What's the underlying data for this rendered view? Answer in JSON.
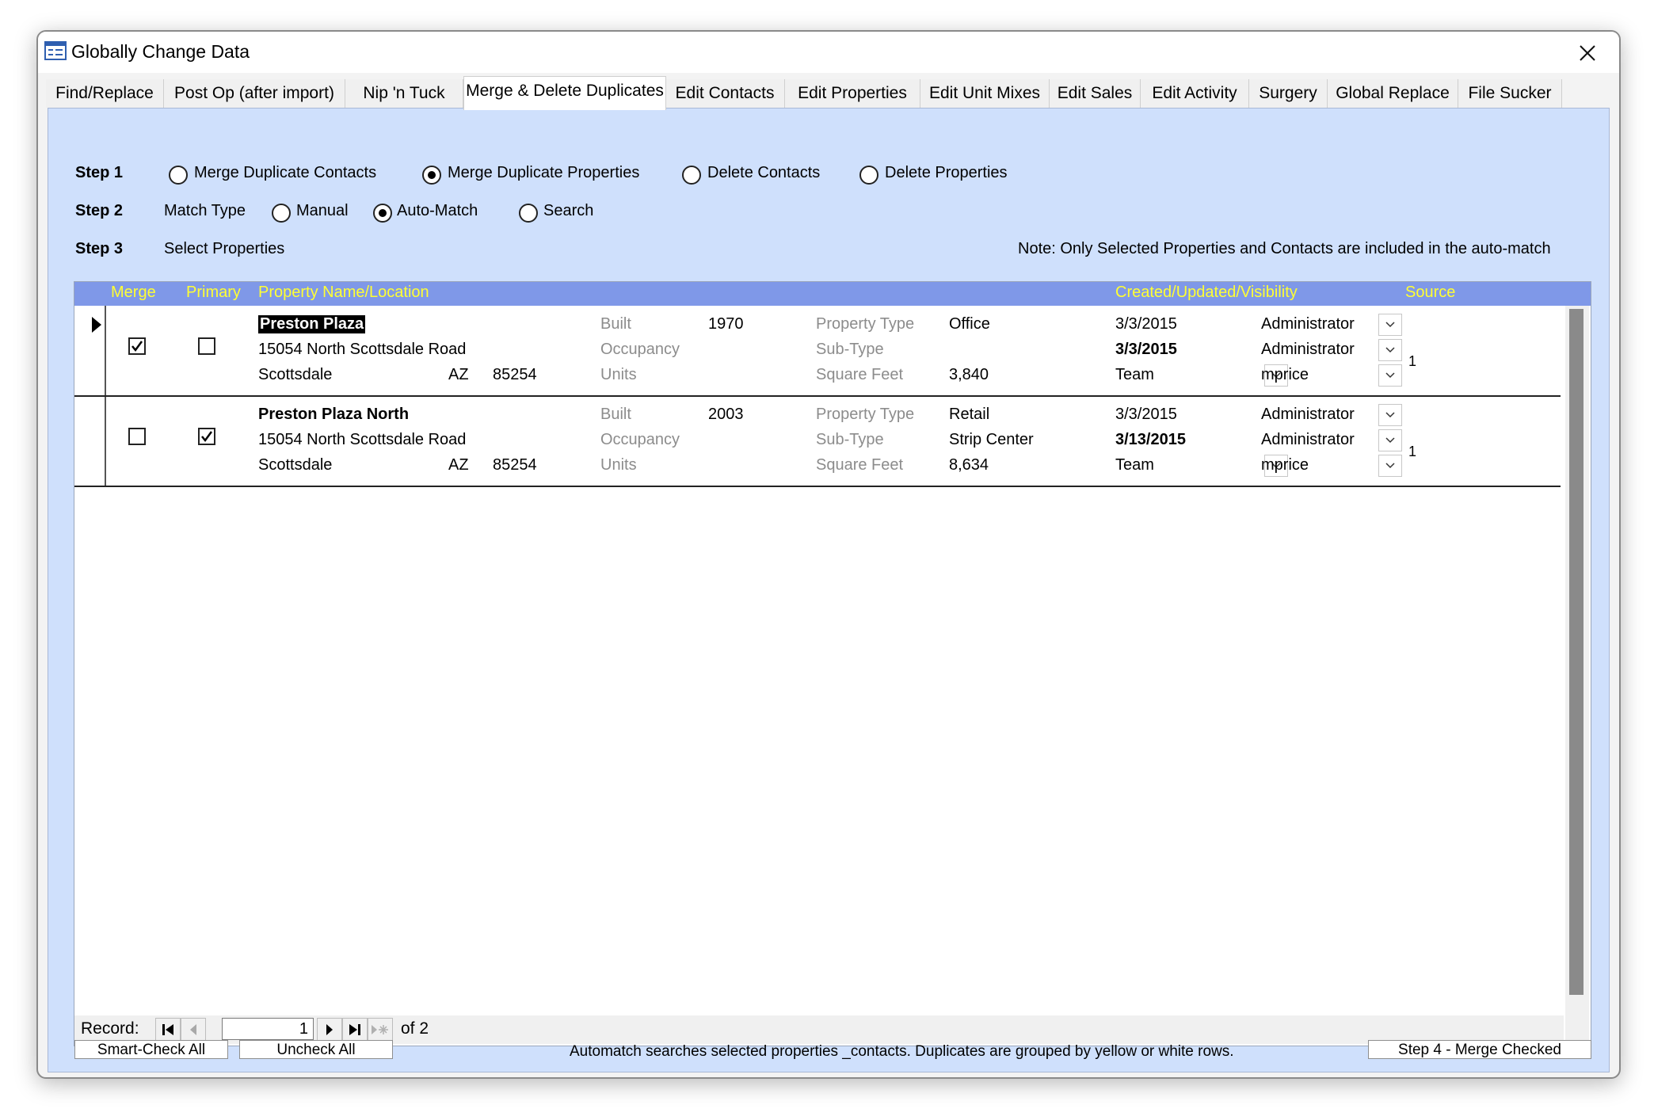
{
  "window": {
    "title": "Globally Change Data"
  },
  "tabs": [
    {
      "label": "Find/Replace"
    },
    {
      "label": "Post Op (after import)"
    },
    {
      "label": "Nip 'n Tuck"
    },
    {
      "label": "Merge & Delete Duplicates",
      "active": true
    },
    {
      "label": "Edit Contacts"
    },
    {
      "label": "Edit Properties"
    },
    {
      "label": "Edit Unit Mixes"
    },
    {
      "label": "Edit Sales"
    },
    {
      "label": "Edit Activity"
    },
    {
      "label": "Surgery"
    },
    {
      "label": "Global Replace"
    },
    {
      "label": "File Sucker"
    }
  ],
  "step1": {
    "label": "Step 1",
    "options": [
      {
        "label": "Merge Duplicate Contacts",
        "selected": false
      },
      {
        "label": "Merge Duplicate Properties",
        "selected": true
      },
      {
        "label": "Delete Contacts",
        "selected": false
      },
      {
        "label": "Delete Properties",
        "selected": false
      }
    ]
  },
  "step2": {
    "label": "Step 2",
    "match_type_label": "Match Type",
    "options": [
      {
        "label": "Manual",
        "selected": false
      },
      {
        "label": "Auto-Match",
        "selected": true
      },
      {
        "label": "Search",
        "selected": false
      }
    ]
  },
  "step3": {
    "label": "Step 3",
    "text": "Select Properties",
    "note": "Note:  Only Selected Properties and Contacts are included in the auto-match"
  },
  "grid": {
    "headers": {
      "merge": "Merge",
      "primary": "Primary",
      "property": "Property Name/Location",
      "created": "Created/Updated/Visibility",
      "source": "Source"
    },
    "field_labels": {
      "built": "Built",
      "occupancy": "Occupancy",
      "units": "Units",
      "property_type": "Property Type",
      "sub_type": "Sub-Type",
      "square_feet": "Square Feet"
    },
    "rows": [
      {
        "merge": true,
        "primary": false,
        "current": true,
        "name": "Preston Plaza",
        "address": "15054 North Scottsdale Road",
        "city": "Scottsdale",
        "state": "AZ",
        "zip": "85254",
        "built": "1970",
        "occupancy": "",
        "units": "",
        "property_type": "Office",
        "sub_type": "",
        "square_feet": "3,840",
        "created": "3/3/2015",
        "updated": "3/3/2015",
        "visibility": "Team",
        "created_by": "Administrator",
        "updated_by": "Administrator",
        "owner": "mprice",
        "source": "1"
      },
      {
        "merge": false,
        "primary": true,
        "current": false,
        "name": "Preston Plaza North",
        "address": "15054 North Scottsdale Road",
        "city": "Scottsdale",
        "state": "AZ",
        "zip": "85254",
        "built": "2003",
        "occupancy": "",
        "units": "",
        "property_type": "Retail",
        "sub_type": "Strip Center",
        "square_feet": "8,634",
        "created": "3/3/2015",
        "updated": "3/13/2015",
        "visibility": "Team",
        "created_by": "Administrator",
        "updated_by": "Administrator",
        "owner": "mprice",
        "source": "1"
      }
    ]
  },
  "navigation": {
    "record_label": "Record:",
    "current": "1",
    "of_label": "of 2"
  },
  "footer": {
    "smart_check_all": "Smart-Check All",
    "uncheck_all": "Uncheck All",
    "info": "Automatch searches selected properties _contacts. Duplicates are grouped by yellow or white rows.",
    "merge_checked": "Step 4 - Merge Checked"
  }
}
